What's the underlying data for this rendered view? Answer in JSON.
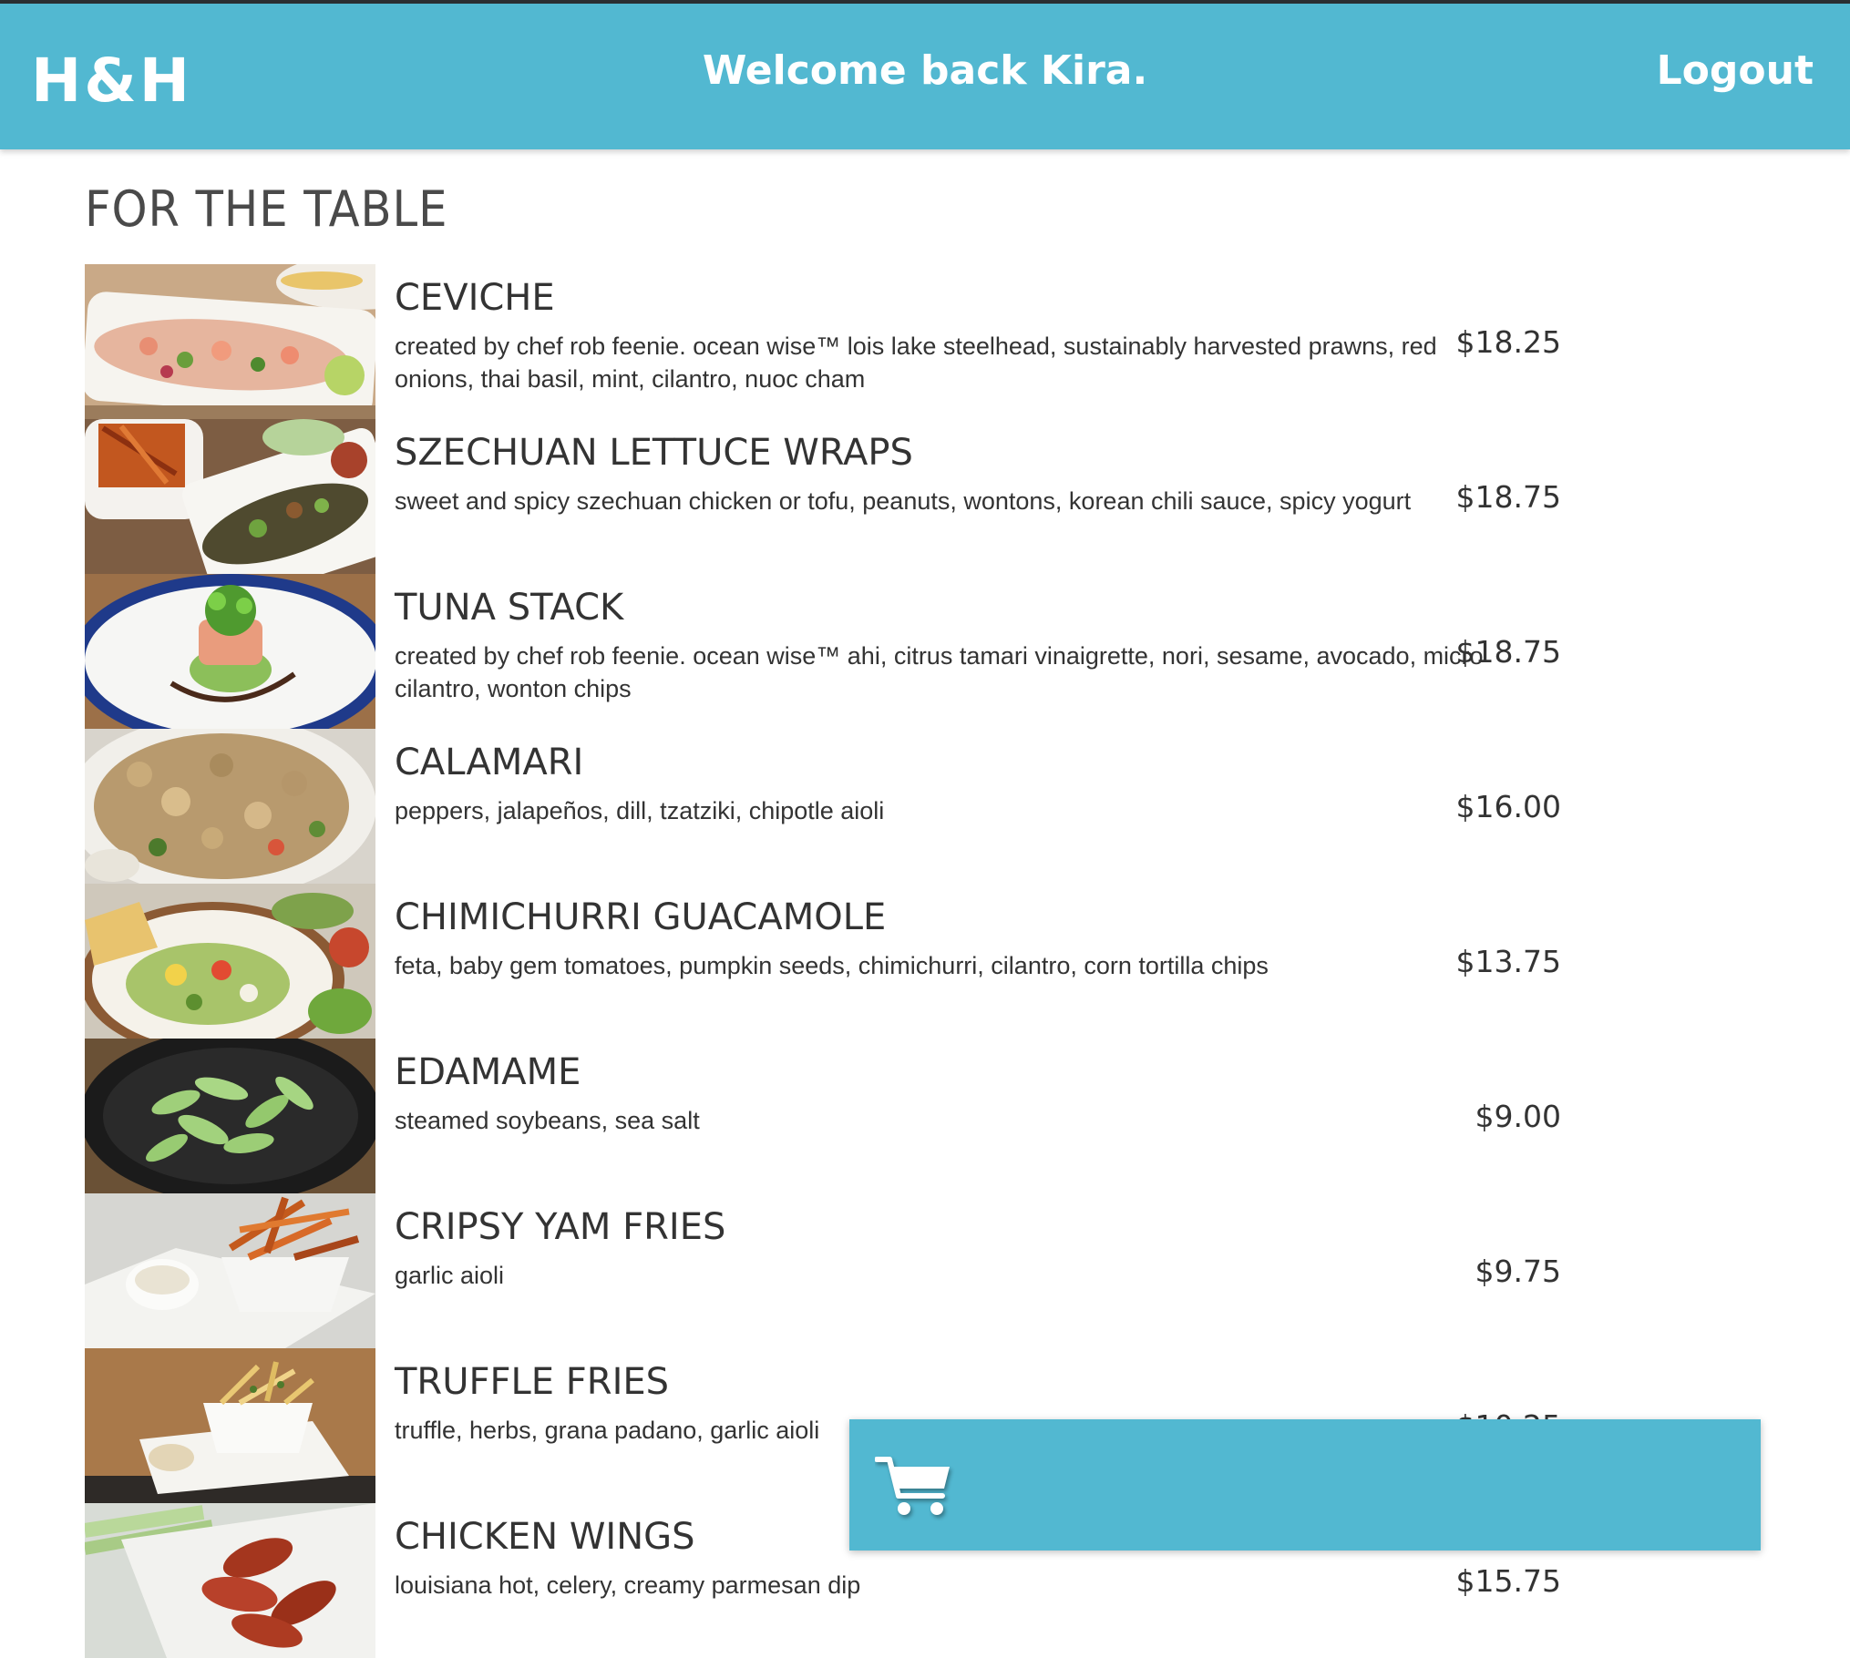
{
  "header": {
    "logo": "H&H",
    "welcome": "Welcome back Kira.",
    "logout_label": "Logout",
    "background_color": "#52b8d1"
  },
  "section": {
    "title": "FOR THE TABLE"
  },
  "items": [
    {
      "name": "CEVICHE",
      "description": "created by chef rob feenie. ocean wise™ lois lake steelhead, sustainably harvested prawns, red onions, thai basil, mint, cilantro, nuoc cham",
      "price": "$18.25"
    },
    {
      "name": "SZECHUAN LETTUCE WRAPS",
      "description": "sweet and spicy szechuan chicken or tofu, peanuts, wontons, korean chili sauce, spicy yogurt",
      "price": "$18.75"
    },
    {
      "name": "TUNA STACK",
      "description": "created by chef rob feenie. ocean wise™ ahi, citrus tamari vinaigrette, nori, sesame, avocado, micro cilantro, wonton chips",
      "price": "$18.75"
    },
    {
      "name": "CALAMARI",
      "description": "peppers, jalapeños, dill, tzatziki, chipotle aioli",
      "price": "$16.00"
    },
    {
      "name": "CHIMICHURRI GUACAMOLE",
      "description": "feta, baby gem tomatoes, pumpkin seeds, chimichurri, cilantro, corn tortilla chips",
      "price": "$13.75"
    },
    {
      "name": "EDAMAME",
      "description": "steamed soybeans, sea salt",
      "price": "$9.00"
    },
    {
      "name": "CRIPSY YAM FRIES",
      "description": "garlic aioli",
      "price": "$9.75"
    },
    {
      "name": "TRUFFLE FRIES",
      "description": "truffle, herbs, grana padano, garlic aioli",
      "price": "$10.25"
    },
    {
      "name": "CHICKEN WINGS",
      "description": "louisiana hot, celery, creamy parmesan dip",
      "price": "$15.75"
    }
  ],
  "cart": {
    "icon": "shopping-cart-icon",
    "background_color": "#52b8d1"
  }
}
